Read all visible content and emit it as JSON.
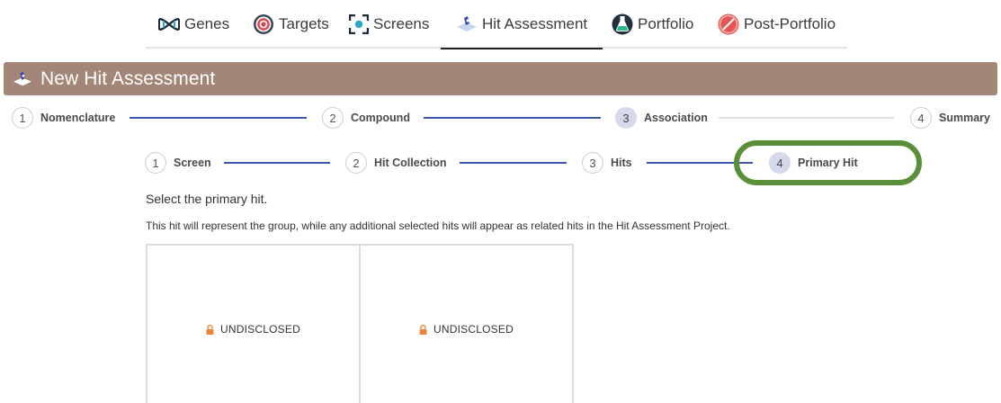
{
  "nav": {
    "items": [
      {
        "label": "Genes",
        "icon": "dna-icon"
      },
      {
        "label": "Targets",
        "icon": "target-icon"
      },
      {
        "label": "Screens",
        "icon": "screen-scan-icon"
      },
      {
        "label": "Hit Assessment",
        "icon": "hit-assessment-icon",
        "active": true
      },
      {
        "label": "Portfolio",
        "icon": "flask-icon"
      },
      {
        "label": "Post-Portfolio",
        "icon": "pill-icon"
      }
    ]
  },
  "header": {
    "title": "New Hit Assessment",
    "color": "#a38677"
  },
  "outer_steps": [
    {
      "number": "1",
      "label": "Nomenclature"
    },
    {
      "number": "2",
      "label": "Compound"
    },
    {
      "number": "3",
      "label": "Association",
      "current": true
    },
    {
      "number": "4",
      "label": "Summary"
    }
  ],
  "inner_steps": [
    {
      "number": "1",
      "label": "Screen"
    },
    {
      "number": "2",
      "label": "Hit Collection"
    },
    {
      "number": "3",
      "label": "Hits"
    },
    {
      "number": "4",
      "label": "Primary Hit",
      "current": true
    }
  ],
  "content": {
    "instruction": "Select the primary hit.",
    "description": "This hit will represent the group, while any additional selected hits will appear as related hits in the Hit Assessment Project."
  },
  "hits": [
    {
      "label": "UNDISCLOSED",
      "icon": "lock-icon"
    },
    {
      "label": "UNDISCLOSED",
      "icon": "lock-icon"
    }
  ],
  "colors": {
    "connector": "#3e55a8",
    "highlight": "#5a8f3a",
    "lock": "#e8853a"
  }
}
